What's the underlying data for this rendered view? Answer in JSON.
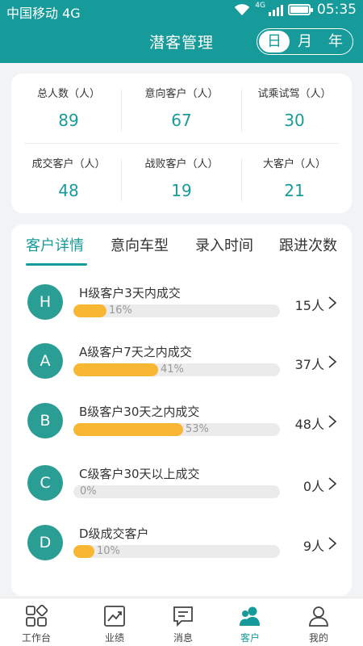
{
  "status_bar": {
    "carrier": "中国移动 4G",
    "network_badge": "4G",
    "time": "05:35"
  },
  "header": {
    "title": "潜客管理",
    "period_options": [
      "日",
      "月",
      "年"
    ],
    "selected_period": "日",
    "color": "#179a9a"
  },
  "stats": [
    {
      "label": "总人数（人）",
      "value": "89"
    },
    {
      "label": "意向客户（人）",
      "value": "67"
    },
    {
      "label": "试乘试驾（人）",
      "value": "30"
    },
    {
      "label": "成交客户（人）",
      "value": "48"
    },
    {
      "label": "战败客户（人）",
      "value": "19"
    },
    {
      "label": "大客户（人）",
      "value": "21"
    }
  ],
  "detail_tabs": [
    "客户详情",
    "意向车型",
    "录入时间",
    "跟进次数"
  ],
  "active_tab": "客户详情",
  "customer_levels": [
    {
      "letter": "H",
      "label": "H级客户3天内成交",
      "percent_text": "16%",
      "percent": 16,
      "count": "15人"
    },
    {
      "letter": "A",
      "label": "A级客户7天之内成交",
      "percent_text": "41%",
      "percent": 41,
      "count": "37人"
    },
    {
      "letter": "B",
      "label": "B级客户30天之内成交",
      "percent_text": "53%",
      "percent": 53,
      "count": "48人"
    },
    {
      "letter": "C",
      "label": "C级客户30天以上成交",
      "percent_text": "0%",
      "percent": 0,
      "count": "0人"
    },
    {
      "letter": "D",
      "label": "D级成交客户",
      "percent_text": "10%",
      "percent": 10,
      "count": "9人"
    }
  ],
  "bar_color": "#f7b733",
  "tabbar": [
    {
      "label": "工作台",
      "icon": "grid-icon"
    },
    {
      "label": "业绩",
      "icon": "trend-chart-icon"
    },
    {
      "label": "消息",
      "icon": "message-icon"
    },
    {
      "label": "客户",
      "icon": "customers-icon",
      "active": true
    },
    {
      "label": "我的",
      "icon": "person-icon"
    }
  ]
}
